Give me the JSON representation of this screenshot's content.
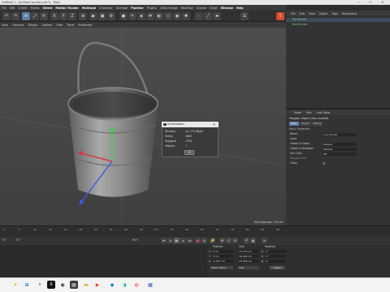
{
  "window": {
    "title": "Untitled 1 - [untitled bucket.c4d *] - Main",
    "min": "—",
    "max": "☐",
    "close": "✕"
  },
  "menubar": [
    "File",
    "Edit",
    "Create",
    "Modes",
    "Select",
    "Tools",
    "Mesh",
    "Spline",
    "Volume",
    "MoGraph",
    "Character",
    "Animate",
    "Simulate",
    "Tracker",
    "Render",
    "Extensions",
    "Window",
    "Help"
  ],
  "menubar_highlight": [
    "Select",
    "Motion Tracker",
    "MoGraph",
    "Pipeline"
  ],
  "topmenu_full": [
    "File",
    "Edit",
    "Create",
    "Modes",
    "Select",
    "Motion Tracker",
    "MoGraph",
    "Character",
    "Animate",
    "Pipeline",
    "Plugins",
    "V-Ray Bridge",
    "RealFlow",
    "Octane",
    "Script",
    "Window",
    "Help"
  ],
  "viewport_menu": [
    "View",
    "Cameras",
    "Display",
    "Options",
    "Filter",
    "Panel",
    "ProRender"
  ],
  "viewport": {
    "grid_label": "Grid Spacing : 10 cm"
  },
  "objmanager": {
    "menu": [
      "File",
      "Edit",
      "View",
      "Object",
      "Tags",
      "Bookmarks"
    ],
    "rows": [
      "Ver Bucket",
      "Bucket Low"
    ]
  },
  "attributes": {
    "menu": [
      "Mode",
      "Edit",
      "User Data"
    ],
    "object_title": "Polygon Object [Iron bucket]",
    "tabs": [
      "Basic",
      "Coord.",
      "Phong"
    ],
    "section": "Basic Properties",
    "rows": [
      {
        "label": "Name",
        "value": "Iron bucket"
      },
      {
        "label": "Layer",
        "value": ""
      },
      {
        "label": "Visible in Editor",
        "value": "Default"
      },
      {
        "label": "Visible in Renderer",
        "value": "Default"
      },
      {
        "label": "Use Color",
        "value": "Off"
      },
      {
        "label": "Display Color",
        "value": ""
      },
      {
        "label": "X-Ray",
        "value": ""
      }
    ]
  },
  "timeline": {
    "ticks": [
      "0",
      "5",
      "10",
      "15",
      "20",
      "25",
      "30",
      "35",
      "40",
      "45",
      "50",
      "55",
      "60",
      "65",
      "70",
      "75",
      "80",
      "85",
      "90"
    ],
    "frame_start": "0 F",
    "frame_end": "90 F",
    "current": "0 F"
  },
  "coords": {
    "headers": [
      "Position",
      "Size",
      "Rotation"
    ],
    "rows": [
      {
        "axis": "X",
        "pos": "0 cm",
        "size": "25.713 cm",
        "rot_axis": "H",
        "rot": "0 °"
      },
      {
        "axis": "Y",
        "pos": "0 cm",
        "size": "30.422 cm",
        "rot_axis": "P",
        "rot": "0 °"
      },
      {
        "axis": "Z",
        "pos": "-0.007 cm",
        "size": "25.639 cm",
        "rot_axis": "B",
        "rot": "0 °"
      }
    ],
    "mode": "Object (Rel)",
    "size_mode": "Size",
    "apply": "Apply"
  },
  "dialog": {
    "title": "Information",
    "rows": [
      {
        "label": "Memory",
        "value": "ca. 172 KByte"
      },
      {
        "label": "Points",
        "value": "1863"
      },
      {
        "label": "Polygons",
        "value": "1755"
      },
      {
        "label": "Objects",
        "value": "1"
      }
    ],
    "ok": "OK"
  },
  "colors": {
    "accent": "#5f7eaa",
    "taskbar": "#f3f3f3",
    "background": "#2d2d2d"
  }
}
